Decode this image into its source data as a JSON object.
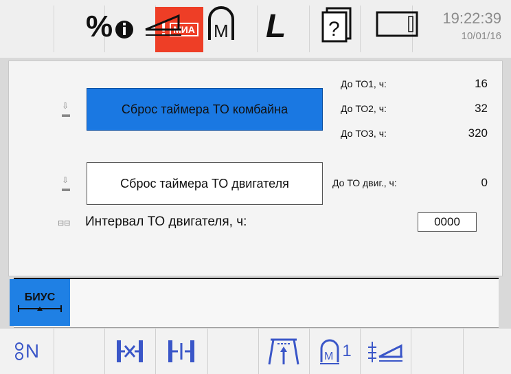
{
  "header": {
    "alarm_text": "МИА",
    "time": "19:22:39",
    "date": "10/01/16"
  },
  "main": {
    "combine_reset_label": "Сброс таймера ТО комбайна",
    "engine_reset_label": "Сброс таймера ТО двигателя",
    "to1_label": "До ТО1, ч:",
    "to1_value": "16",
    "to2_label": "До ТО2, ч:",
    "to2_value": "32",
    "to3_label": "До ТО3, ч:",
    "to3_value": "320",
    "engine_to_label": "До ТО двиг., ч:",
    "engine_to_value": "0",
    "interval_label": "Интервал ТО двигателя, ч:",
    "interval_value": "0000"
  },
  "toolbar": {
    "biuss_label": "БИУС",
    "items": [
      "biuss-icon",
      "engine-info-icon",
      "header-icon",
      "m-icon",
      "l-icon",
      "help-icon",
      "screen-icon"
    ]
  },
  "bottombar": {
    "gear_label": "N",
    "pwr_label": "1"
  },
  "colors": {
    "accent_blue": "#1a78e2",
    "alarm_red": "#ee3e26",
    "bottom_icon": "#3a56c8"
  }
}
